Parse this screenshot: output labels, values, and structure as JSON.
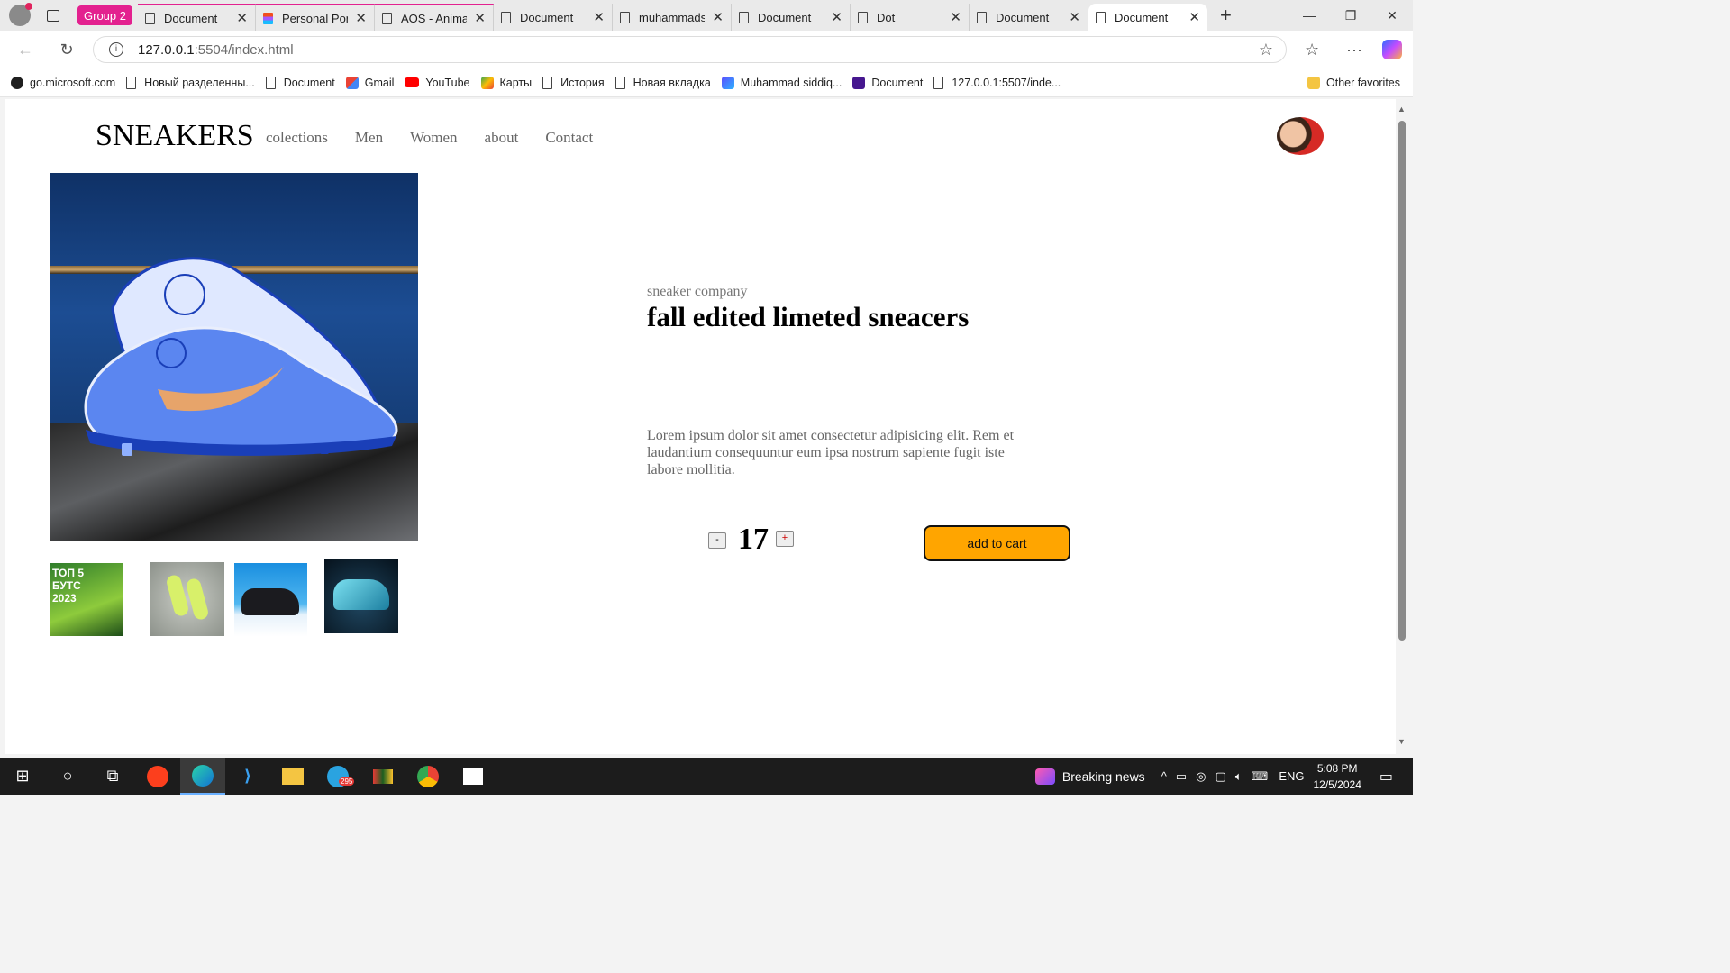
{
  "browser": {
    "group_label": "Group 2",
    "tabs": [
      {
        "title": "Document"
      },
      {
        "title": "Personal Port"
      },
      {
        "title": "AOS - Anima"
      },
      {
        "title": "Document"
      },
      {
        "title": "muhammads"
      },
      {
        "title": "Document"
      },
      {
        "title": "Dot"
      },
      {
        "title": "Document"
      },
      {
        "title": "Document"
      }
    ],
    "url_host": "127.0.0.1",
    "url_rest": ":5504/index.html",
    "bookmarks": [
      "go.microsoft.com",
      "Новый разделенны...",
      "Document",
      "Gmail",
      "YouTube",
      "Карты",
      "История",
      "Новая вкладка",
      "Muhammad siddiq...",
      "Document",
      "127.0.0.1:5507/inde..."
    ],
    "other_favorites": "Other favorites"
  },
  "page": {
    "brand": "SNEAKERS",
    "nav": [
      "colections",
      "Men",
      "Women",
      "about",
      "Contact"
    ],
    "company": "sneaker company",
    "title": "fall edited limeted sneacers",
    "description": "Lorem ipsum dolor sit amet consectetur adipisicing elit. Rem et laudantium consequuntur eum ipsa nostrum sapiente fugit iste labore mollitia.",
    "qty_minus": "-",
    "qty_plus": "+",
    "quantity": "17",
    "add_to_cart": "add to cart",
    "thumb1_text": "ТОП 5 БУТС 2023"
  },
  "taskbar": {
    "news": "Breaking news",
    "lang": "ENG",
    "time": "5:08 PM",
    "date": "12/5/2024",
    "telegram_badge": "295"
  }
}
